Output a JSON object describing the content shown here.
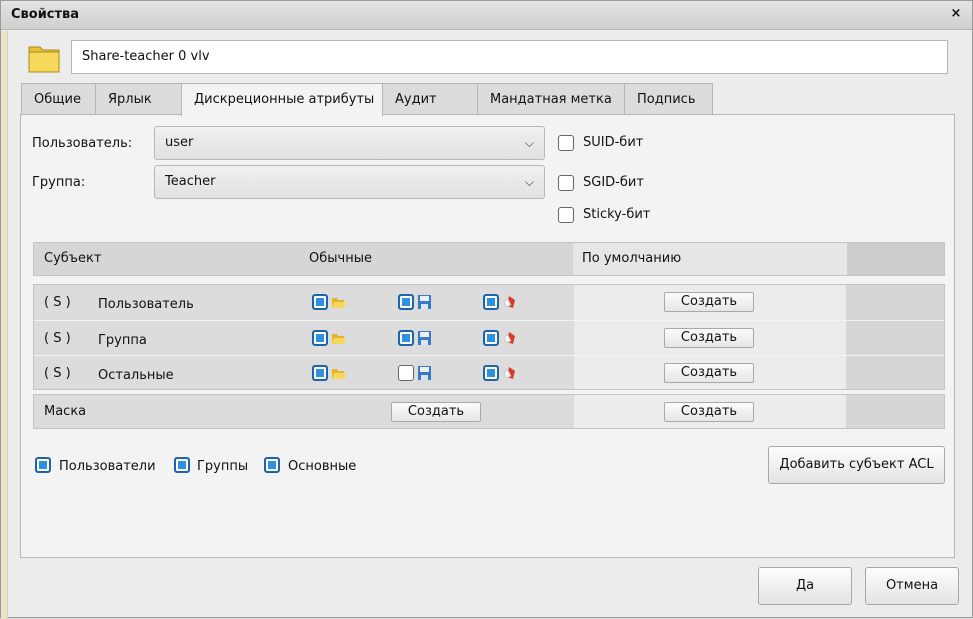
{
  "window": {
    "title": "Свойства",
    "close_glyph": "×"
  },
  "file": {
    "name": "Share-teacher 0 vlv",
    "icon": "folder-icon"
  },
  "tabs": [
    {
      "label": "Общие",
      "active": false
    },
    {
      "label": "Ярлык",
      "active": false
    },
    {
      "label": "Дискреционные атрибуты",
      "active": true
    },
    {
      "label": "Аудит",
      "active": false
    },
    {
      "label": "Мандатная метка",
      "active": false
    },
    {
      "label": "Подпись",
      "active": false
    }
  ],
  "owner": {
    "user_label": "Пользователь:",
    "user_value": "user",
    "group_label": "Группа:",
    "group_value": "Teacher",
    "arrow": "⌵"
  },
  "special_bits": {
    "suid": {
      "label": "SUID-бит",
      "checked": false
    },
    "sgid": {
      "label": "SGID-бит",
      "checked": false
    },
    "sticky": {
      "label": "Sticky-бит",
      "checked": false
    }
  },
  "table": {
    "headers": {
      "subject": "Субъект",
      "normal": "Обычные",
      "default": "По умолчанию"
    },
    "rows": [
      {
        "tag": "( S )",
        "name": "Пользователь",
        "perms": [
          true,
          true,
          true
        ],
        "create_label": "Создать"
      },
      {
        "tag": "( S )",
        "name": "Группа",
        "perms": [
          true,
          true,
          true
        ],
        "create_label": "Создать"
      },
      {
        "tag": "( S )",
        "name": "Остальные",
        "perms": [
          true,
          false,
          true
        ],
        "create_label": "Создать"
      }
    ],
    "mask": {
      "label": "Маска",
      "create_normal_label": "Создать",
      "create_default_label": "Создать"
    }
  },
  "filters": {
    "users": {
      "label": "Пользователи",
      "checked": true
    },
    "groups": {
      "label": "Группы",
      "checked": true
    },
    "basic": {
      "label": "Основные",
      "checked": true
    }
  },
  "buttons": {
    "add_acl": "Добавить субъект ACL",
    "ok": "Да",
    "cancel": "Отмена"
  },
  "colors": {
    "accent": "#2f8fe0",
    "background": "#ececec",
    "panel": "#f3f3f3"
  }
}
